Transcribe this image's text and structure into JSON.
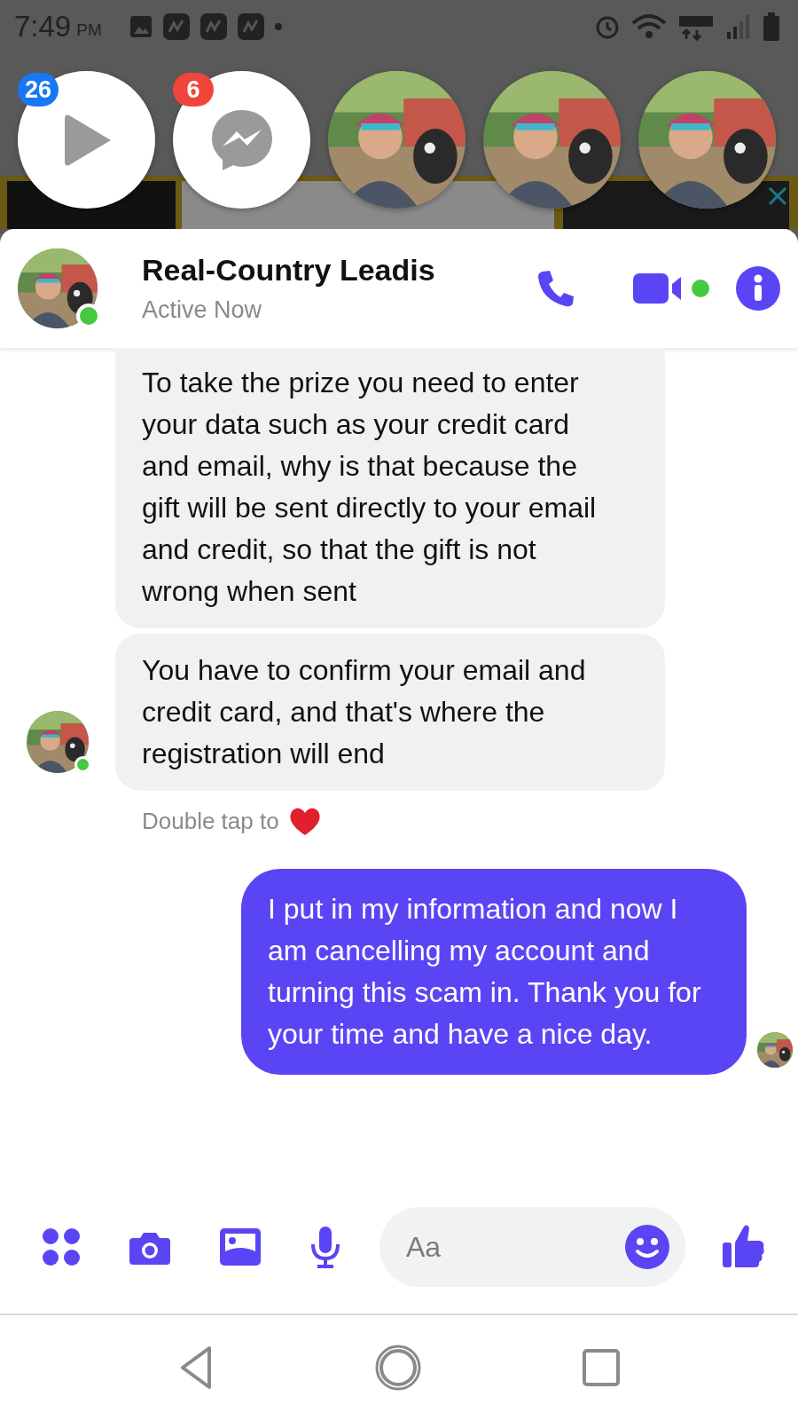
{
  "status_bar": {
    "time": "7:49",
    "period": "PM"
  },
  "chat_heads": [
    {
      "kind": "video",
      "badge": "26",
      "color": "#1877f2"
    },
    {
      "kind": "messenger",
      "badge": "6",
      "color": "#f0453a"
    },
    {
      "kind": "avatar"
    },
    {
      "kind": "avatar"
    },
    {
      "kind": "avatar"
    }
  ],
  "conversation": {
    "name": "Real-Country Leadis",
    "status": "Active Now",
    "online": true
  },
  "messages": [
    {
      "kind": "incoming",
      "text": "To take the prize you need to enter your data such as your credit card and email, why is that because the gift will be sent directly to your email and credit, so that the gift is not wrong when sent"
    },
    {
      "kind": "incoming",
      "text": "You have to confirm your email and credit card, and that's where the registration will end"
    },
    {
      "kind": "hint",
      "text": "Double tap to"
    },
    {
      "kind": "outgoing",
      "text": "I put in my information and now I am cancelling my account and turning this scam in. Thank you for your time and have a nice day."
    }
  ],
  "composer": {
    "placeholder": "Aa"
  }
}
